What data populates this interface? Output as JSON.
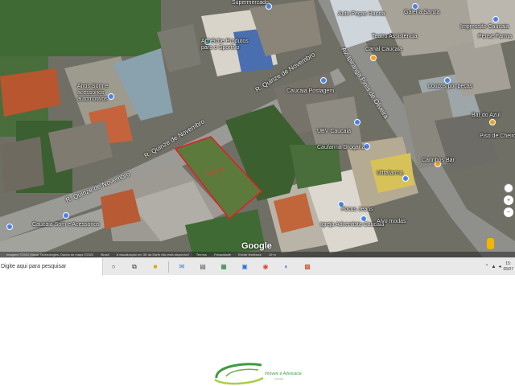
{
  "map": {
    "streets": {
      "quinze_a": "R. Quinze de Novembro",
      "quinze_b": "R. Quinze de Novembro",
      "quinze_c": "R. Quinze de Novembro",
      "ipiranga": "Av. Ipiranga Pires de Oliveira"
    },
    "places": {
      "supermercado": "Supermercado",
      "acheiche": "Achéiche Produtos para o Sportivo",
      "anos": "Anos Som e acessórios automotivos",
      "caucaia_postagem": "Caucaia Postagem",
      "ubv": "UBV Caucaia",
      "caufarma": "Caufarma Drogaria",
      "ultrafarma": "Ultrafarma",
      "focus": "Focus Jeans",
      "igreja": "Igreja Adventista Caucaia",
      "alvo": "Alvo modas",
      "carinhos": "Carinhos Bar",
      "bar_azul": "Bar do Azul",
      "piso": "Piso de Cheiro",
      "loucos": "Loucos por peças",
      "pense": "Pense Farma",
      "impressao": "Impressão Caucaia",
      "galeria": "Galeria Sanza",
      "teatro": "Teatro Assistência",
      "caucaia_som": "Caucaia Som e Acessórios",
      "autopecas": "Auto Peças Handa",
      "canal": "Canal Caucaia"
    },
    "parcel_label": "Área: 5",
    "google": "Google",
    "attribution": [
      "Imagens ©2022 Maxar Technologies, Dados do mapa ©2022",
      "Brasil",
      "A visualização em 3D da Earth não está disponível",
      "Termos",
      "Privacidade",
      "Enviar feedback",
      "10 m"
    ]
  },
  "taskbar": {
    "search_placeholder": "Digite aqui para pesquisar",
    "time": "15:",
    "date": "05/07"
  },
  "colors": {
    "parcel_outline": "#e02020",
    "pin_blue": "#4a82e8",
    "pin_orange": "#f0a020",
    "logo_green": "#3d9b40"
  },
  "footer": {
    "brand": "Imóveis e Advocacia",
    "sub": "Caucaia"
  }
}
